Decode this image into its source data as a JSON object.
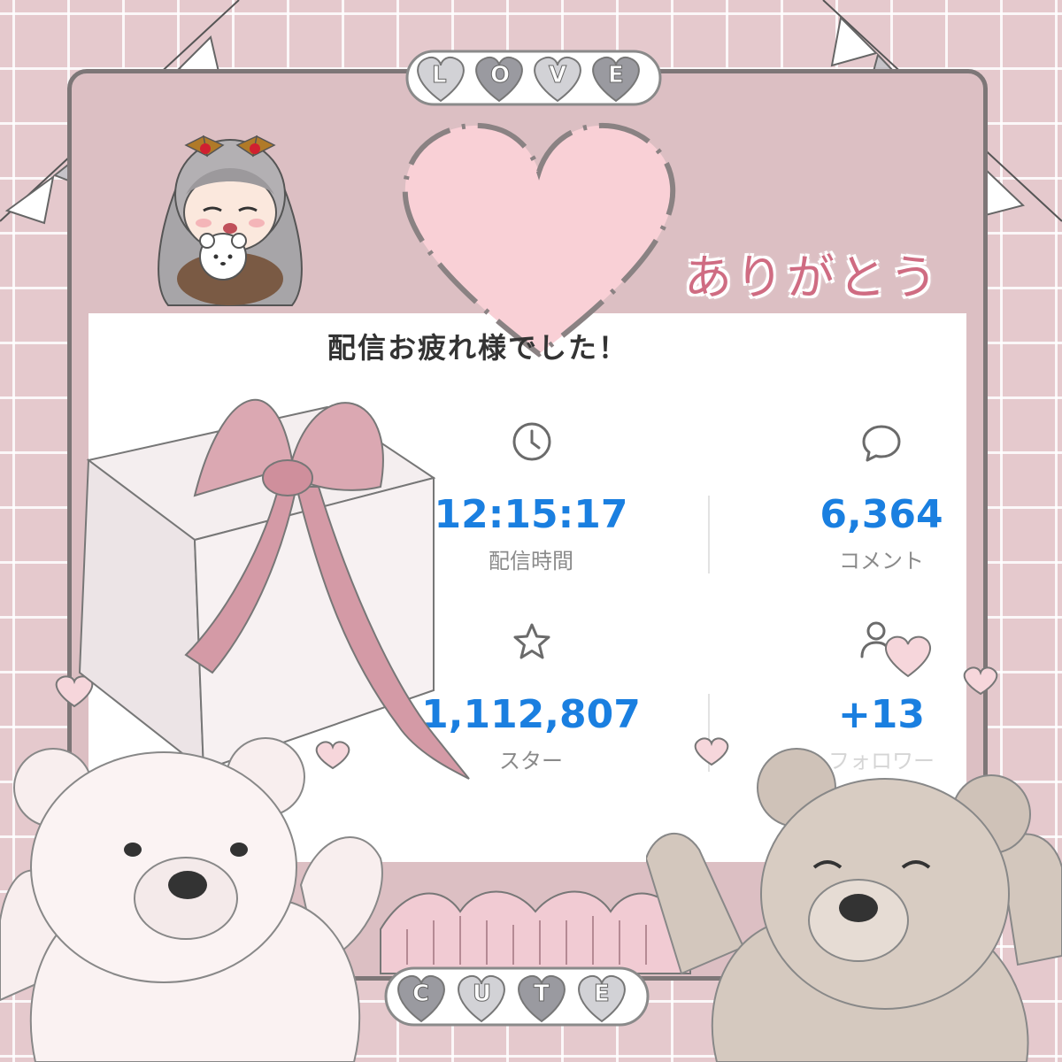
{
  "header": {
    "badge_top": [
      "L",
      "O",
      "V",
      "E"
    ],
    "badge_bottom": [
      "C",
      "U",
      "T",
      "E"
    ],
    "arigatou": "ありがとう"
  },
  "card": {
    "title": "配信お疲れ様でした！",
    "stats": [
      {
        "icon": "clock-icon",
        "value": "12:15:17",
        "label": "配信時間"
      },
      {
        "icon": "comment-bubble-icon",
        "value": "6,364",
        "label": "コメント"
      },
      {
        "icon": "star-icon",
        "value": "1,112,807",
        "label": "スター"
      },
      {
        "icon": "follower-icon",
        "value": "+13",
        "label": "フォロワー"
      }
    ]
  },
  "colors": {
    "accent": "#1a7fe0",
    "background": "#e5c9cd",
    "heart": "#f9d0d6",
    "ribbon": "#d9a9b1"
  }
}
